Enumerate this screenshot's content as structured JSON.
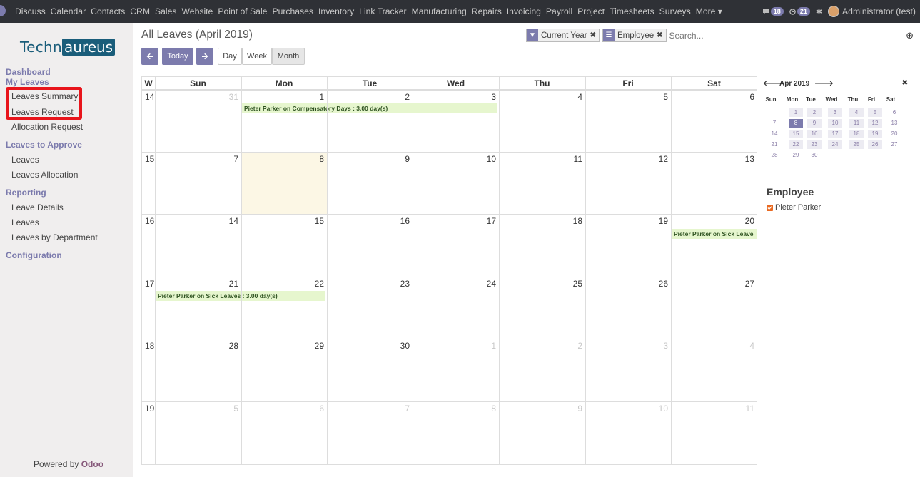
{
  "menu": [
    "Discuss",
    "Calendar",
    "Contacts",
    "CRM",
    "Sales",
    "Website",
    "Point of Sale",
    "Purchases",
    "Inventory",
    "Link Tracker",
    "Manufacturing",
    "Repairs",
    "Invoicing",
    "Payroll",
    "Project",
    "Timesheets",
    "Surveys",
    "More ▾"
  ],
  "topright": {
    "messages": "18",
    "activities": "21",
    "user": "Administrator (test)"
  },
  "logo": {
    "part1": "Techn",
    "part2": "aureus"
  },
  "sidebar": {
    "sec1": "Dashboard",
    "sec2": "My Leaves",
    "item1": "Leaves Summary",
    "item2": "Leaves Request",
    "item3": "Allocation Request",
    "sec3": "Leaves to Approve",
    "item4": "Leaves",
    "item5": "Leaves Allocation",
    "sec4": "Reporting",
    "item6": "Leave Details",
    "item7": "Leaves",
    "item8": "Leaves by Department",
    "sec5": "Configuration",
    "powered_prefix": "Powered by",
    "powered_brand": "Odoo"
  },
  "page": {
    "title": "All Leaves (April 2019)"
  },
  "buttons": {
    "today": "Today",
    "day": "Day",
    "week": "Week",
    "month": "Month"
  },
  "search": {
    "facet1": "Current Year",
    "facet2": "Employee",
    "placeholder": "Search..."
  },
  "calendar": {
    "week_col": "W",
    "days": [
      "Sun",
      "Mon",
      "Tue",
      "Wed",
      "Thu",
      "Fri",
      "Sat"
    ],
    "weeks": [
      {
        "w": "14",
        "d": [
          "31",
          "1",
          "2",
          "3",
          "4",
          "5",
          "6"
        ],
        "other": [
          true,
          false,
          false,
          false,
          false,
          false,
          false
        ]
      },
      {
        "w": "15",
        "d": [
          "7",
          "8",
          "9",
          "10",
          "11",
          "12",
          "13"
        ],
        "other": [
          false,
          false,
          false,
          false,
          false,
          false,
          false
        ]
      },
      {
        "w": "16",
        "d": [
          "14",
          "15",
          "16",
          "17",
          "18",
          "19",
          "20"
        ],
        "other": [
          false,
          false,
          false,
          false,
          false,
          false,
          false
        ]
      },
      {
        "w": "17",
        "d": [
          "21",
          "22",
          "23",
          "24",
          "25",
          "26",
          "27"
        ],
        "other": [
          false,
          false,
          false,
          false,
          false,
          false,
          false
        ]
      },
      {
        "w": "18",
        "d": [
          "28",
          "29",
          "30",
          "1",
          "2",
          "3",
          "4"
        ],
        "other": [
          false,
          false,
          false,
          true,
          true,
          true,
          true
        ]
      },
      {
        "w": "19",
        "d": [
          "5",
          "6",
          "7",
          "8",
          "9",
          "10",
          "11"
        ],
        "other": [
          true,
          true,
          true,
          true,
          true,
          true,
          true
        ]
      }
    ],
    "events": {
      "e1": "Pieter Parker on Compensatory Days : 3.00 day(s)",
      "e2": "Pieter Parker on Sick Leave",
      "e3": "Pieter Parker on Sick Leaves : 3.00 day(s)"
    }
  },
  "mini": {
    "label": "Apr 2019",
    "days": [
      "Sun",
      "Mon",
      "Tue",
      "Wed",
      "Thu",
      "Fri",
      "Sat"
    ],
    "rows": [
      [
        "",
        "1",
        "2",
        "3",
        "4",
        "5",
        "6"
      ],
      [
        "7",
        "8",
        "9",
        "10",
        "11",
        "12",
        "13"
      ],
      [
        "14",
        "15",
        "16",
        "17",
        "18",
        "19",
        "20"
      ],
      [
        "21",
        "22",
        "23",
        "24",
        "25",
        "26",
        "27"
      ],
      [
        "28",
        "29",
        "30",
        "",
        "",
        "",
        ""
      ]
    ]
  },
  "filters": {
    "title": "Employee",
    "item1": "Pieter Parker"
  },
  "colors": {
    "accent": "#7c7bad",
    "event": "#e6f6ce",
    "today": "#fcf7e5",
    "highlight": "#e8141b"
  }
}
